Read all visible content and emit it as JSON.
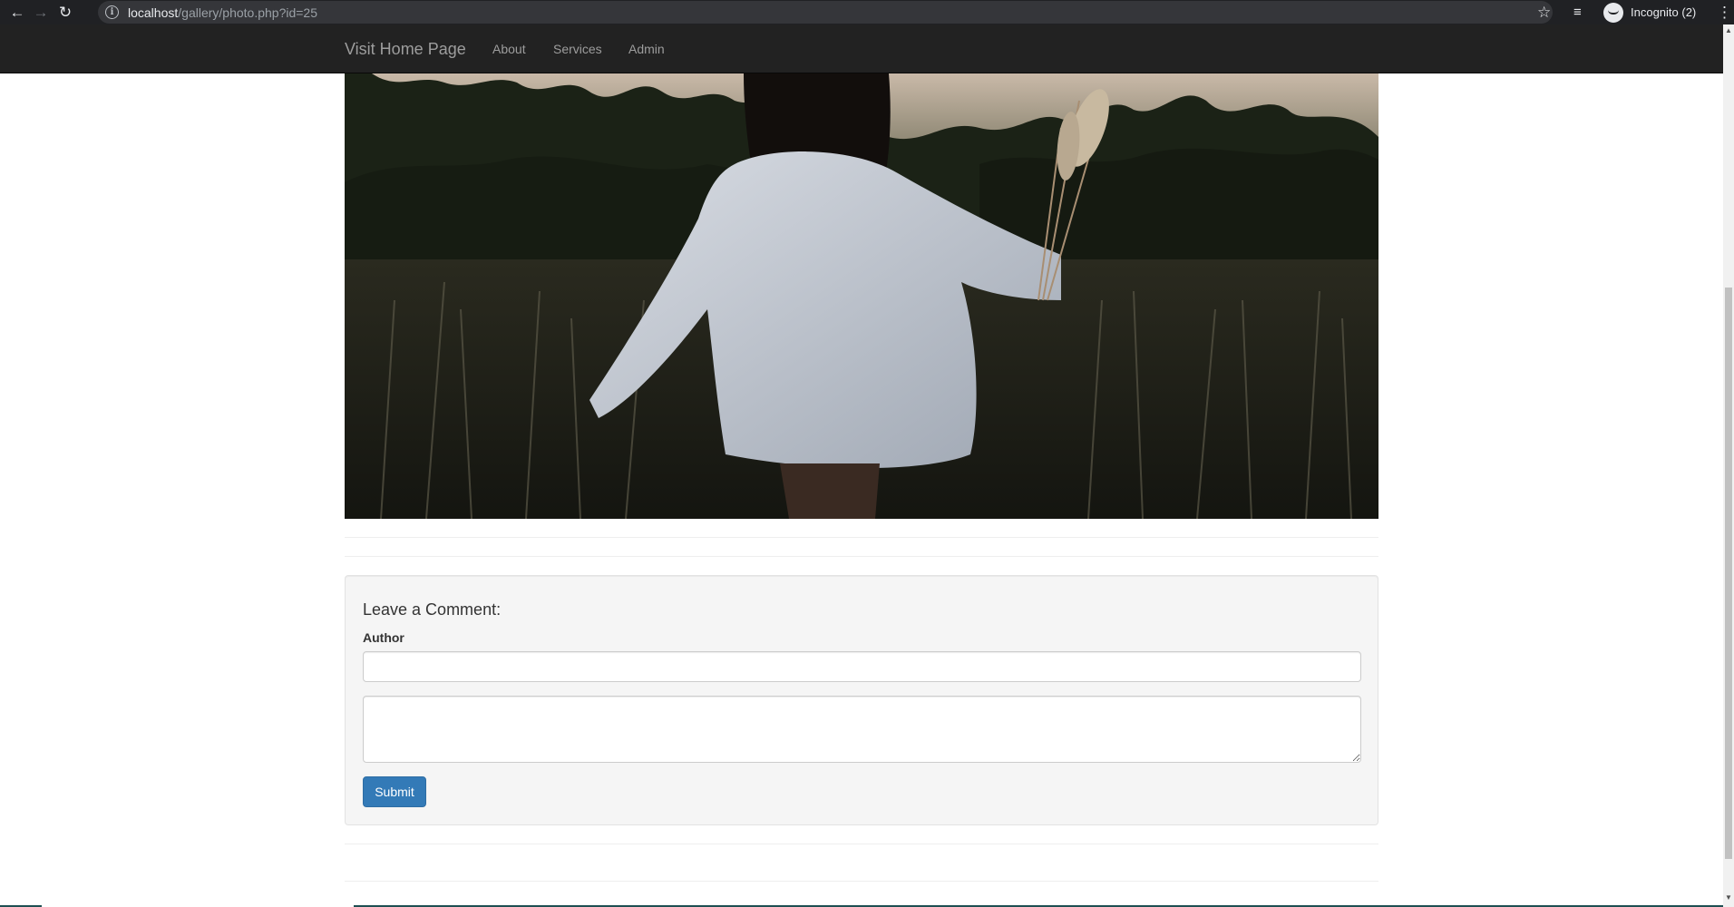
{
  "browser": {
    "url_host": "localhost",
    "url_path": "/gallery/photo.php?id=25",
    "profile_label": "Incognito (2)",
    "icons": [
      "back-icon",
      "forward-icon",
      "reload-icon",
      "info-icon",
      "star-icon",
      "media-control-icon",
      "incognito-icon",
      "menu-icon"
    ]
  },
  "navbar": {
    "brand": "Visit Home Page",
    "links": [
      "About",
      "Services",
      "Admin"
    ]
  },
  "photo": {
    "description": "photo"
  },
  "comment_form": {
    "heading": "Leave a Comment:",
    "author_label": "Author",
    "author_value": "",
    "comment_value": "",
    "submit_label": "Submit"
  },
  "colors": {
    "navbar_bg": "#222222",
    "button_primary": "#337ab7",
    "well_bg": "#f5f5f5"
  }
}
